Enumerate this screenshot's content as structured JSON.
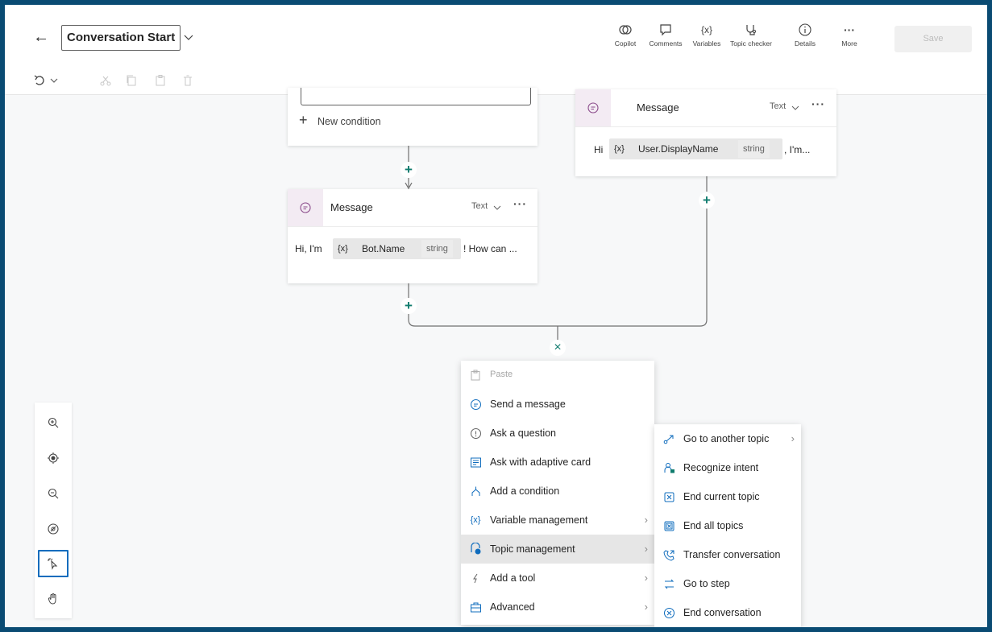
{
  "header": {
    "title": "Conversation Start",
    "tools": [
      {
        "label": "Copilot",
        "icon": "copilot-icon"
      },
      {
        "label": "Comments",
        "icon": "comment-icon"
      },
      {
        "label": "Variables",
        "icon": "variable-icon"
      },
      {
        "label": "Topic checker",
        "icon": "stethoscope-icon"
      },
      {
        "label": "Details",
        "icon": "info-icon"
      },
      {
        "label": "More",
        "icon": "more-icon"
      }
    ],
    "save_label": "Save"
  },
  "canvas": {
    "condition_card": {
      "new_condition_label": "New condition"
    },
    "message_card_left": {
      "title": "Message",
      "type_label": "Text",
      "prefix": "Hi, I'm",
      "var_symbol": "{x}",
      "var_name": "Bot.Name",
      "var_type": "string",
      "suffix": "! How can ..."
    },
    "message_card_right": {
      "title": "Message",
      "type_label": "Text",
      "prefix": "Hi",
      "var_symbol": "{x}",
      "var_name": "User.DisplayName",
      "var_type": "string",
      "suffix": ", I'm..."
    }
  },
  "add_node_menu": {
    "items": [
      {
        "label": "Paste",
        "icon": "paste-icon",
        "disabled": true
      },
      {
        "label": "Send a message",
        "icon": "message-icon"
      },
      {
        "label": "Ask a question",
        "icon": "question-icon"
      },
      {
        "label": "Ask with adaptive card",
        "icon": "adaptive-card-icon"
      },
      {
        "label": "Add a condition",
        "icon": "condition-icon"
      },
      {
        "label": "Variable management",
        "icon": "variable-icon",
        "submenu": true
      },
      {
        "label": "Topic management",
        "icon": "topic-icon",
        "submenu": true,
        "active": true
      },
      {
        "label": "Add a tool",
        "icon": "tool-icon",
        "submenu": true
      },
      {
        "label": "Advanced",
        "icon": "advanced-icon",
        "submenu": true
      }
    ]
  },
  "topic_submenu": {
    "items": [
      {
        "label": "Go to another topic",
        "icon": "redirect-icon",
        "submenu": true
      },
      {
        "label": "Recognize intent",
        "icon": "recognize-icon"
      },
      {
        "label": "End current topic",
        "icon": "end-topic-icon"
      },
      {
        "label": "End all topics",
        "icon": "end-all-icon"
      },
      {
        "label": "Transfer conversation",
        "icon": "transfer-icon"
      },
      {
        "label": "Go to step",
        "icon": "goto-step-icon"
      },
      {
        "label": "End conversation",
        "icon": "end-conversation-icon"
      }
    ]
  },
  "colors": {
    "accent": "#0f6cbd",
    "plus": "#107c6e",
    "frame": "#0a4b73"
  }
}
